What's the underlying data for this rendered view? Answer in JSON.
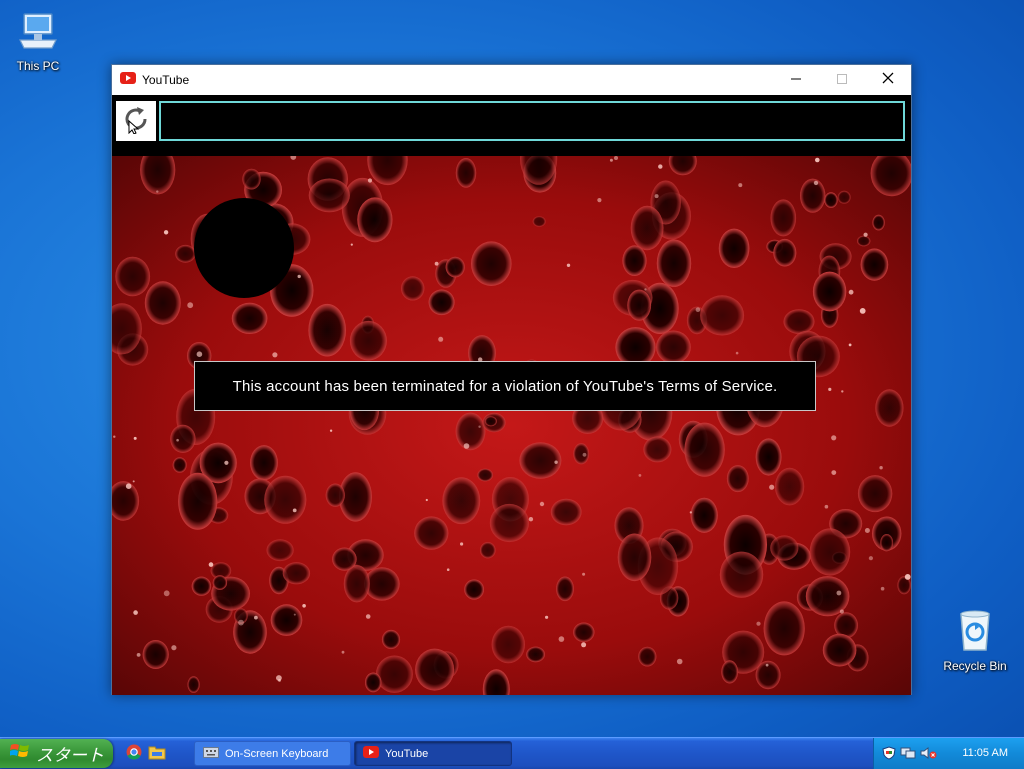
{
  "desktop": {
    "icons": [
      {
        "label": "This PC"
      },
      {
        "label": "Recycle Bin"
      }
    ]
  },
  "window": {
    "title": "YouTube",
    "address_value": "",
    "message": "This account has been terminated for a violation of YouTube's Terms of Service."
  },
  "taskbar": {
    "start_label": "スタート",
    "tasks": [
      {
        "label": "On-Screen Keyboard"
      },
      {
        "label": "YouTube"
      }
    ],
    "clock": "11:05 AM"
  },
  "icons": [
    "computer-icon",
    "recycle-bin-icon",
    "youtube-icon",
    "minimize-icon",
    "maximize-icon",
    "close-icon",
    "refresh-icon",
    "windows-flag-icon",
    "chrome-icon",
    "folder-icon",
    "keyboard-icon",
    "security-icon",
    "network-icon",
    "volume-muted-icon"
  ],
  "colors": {
    "desktop": "#1a74d6",
    "taskbar": "#1f56c9",
    "start": "#3c9a3c",
    "address_border": "#6fd8d8",
    "content_red": "#b81010"
  }
}
